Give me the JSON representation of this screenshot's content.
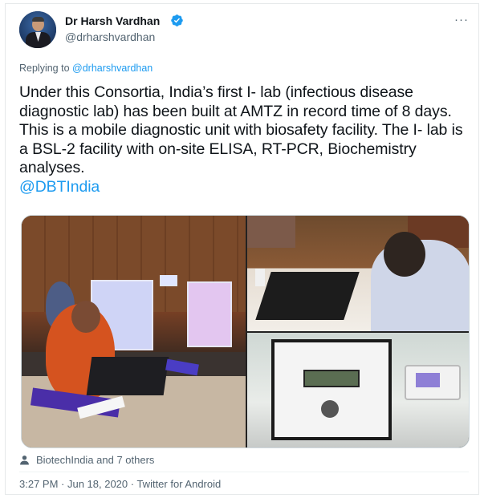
{
  "author": {
    "name": "Dr Harsh Vardhan",
    "handle": "@drharshvardhan",
    "verified": true
  },
  "more_label": "···",
  "reply": {
    "prefix": "Replying to ",
    "target": "@drharshvardhan"
  },
  "tweet": {
    "text": "Under this Consortia, India’s first I- lab (infectious disease diagnostic lab) has been built at AMTZ in record time of 8 days. This is a mobile diagnostic unit with biosafety facility. The I- lab is a BSL-2 facility with on-site ELISA, RT-PCR, Biochemistry analyses.",
    "mention": "@DBTIndia"
  },
  "media": {
    "count": 3
  },
  "likes_line": "BiotechIndia and 7 others",
  "timestamp": "3:27 PM · Jun 18, 2020 · Twitter for Android",
  "colors": {
    "accent": "#1d9bf0",
    "text": "#0f1419",
    "muted": "#536471"
  }
}
